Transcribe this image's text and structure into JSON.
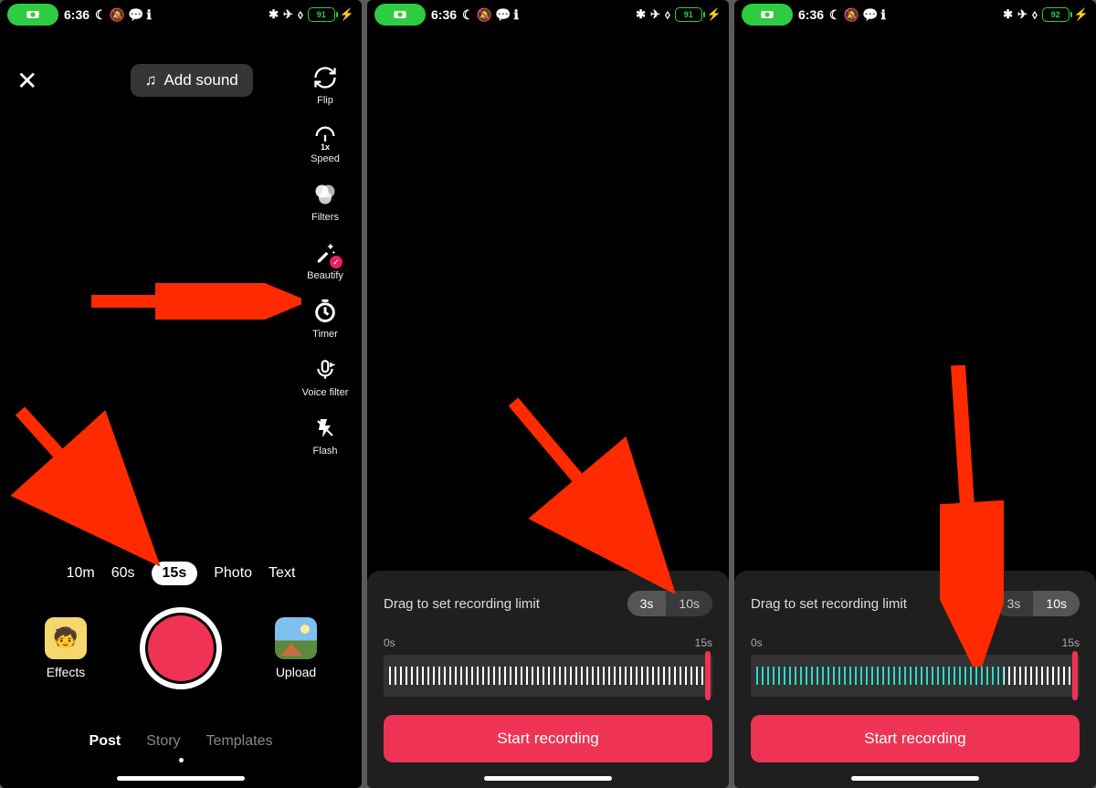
{
  "status": {
    "time": "6:36",
    "battery1": "91",
    "battery3": "92"
  },
  "screen1": {
    "add_sound": "Add sound",
    "tools": {
      "flip": "Flip",
      "speed": "Speed",
      "filters": "Filters",
      "beautify": "Beautify",
      "timer": "Timer",
      "voice_filter": "Voice filter",
      "flash": "Flash"
    },
    "durations": [
      "10m",
      "60s",
      "15s",
      "Photo",
      "Text"
    ],
    "effects": "Effects",
    "upload": "Upload",
    "tabs": {
      "post": "Post",
      "story": "Story",
      "templates": "Templates"
    }
  },
  "panel": {
    "title": "Drag to set recording limit",
    "opt3": "3s",
    "opt10": "10s",
    "start": "0s",
    "end": "15s",
    "button": "Start recording"
  },
  "screen3_teal_pct": 78
}
